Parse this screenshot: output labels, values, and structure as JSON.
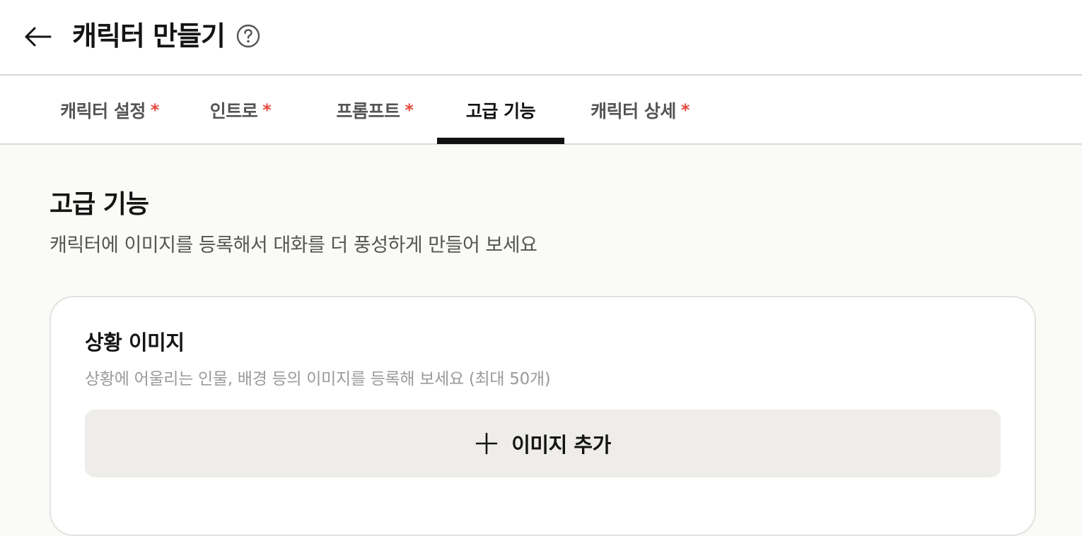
{
  "header": {
    "back_icon": "arrow-left-icon",
    "title": "캐릭터 만들기",
    "help_icon": "question-circle-icon"
  },
  "tabs": [
    {
      "label": "캐릭터 설정",
      "required_mark": "*",
      "active": false
    },
    {
      "label": "인트로",
      "required_mark": "*",
      "active": false
    },
    {
      "label": "프롬프트",
      "required_mark": "*",
      "active": false
    },
    {
      "label": "고급 기능",
      "required_mark": "",
      "active": true
    },
    {
      "label": "캐릭터 상세",
      "required_mark": "*",
      "active": false
    }
  ],
  "section": {
    "title": "고급 기능",
    "description": "캐릭터에 이미지를 등록해서 대화를 더 풍성하게 만들어 보세요"
  },
  "card": {
    "title": "상황 이미지",
    "description": "상황에 어울리는 인물, 배경 등의 이미지를 등록해 보세요 (최대 50개)",
    "add_button_label": "이미지 추가",
    "add_icon": "plus-icon"
  },
  "colors": {
    "required_mark": "#e5493d",
    "active_tab_underline": "#111111",
    "page_background": "#fafaf6",
    "add_button_background": "#efedea"
  }
}
